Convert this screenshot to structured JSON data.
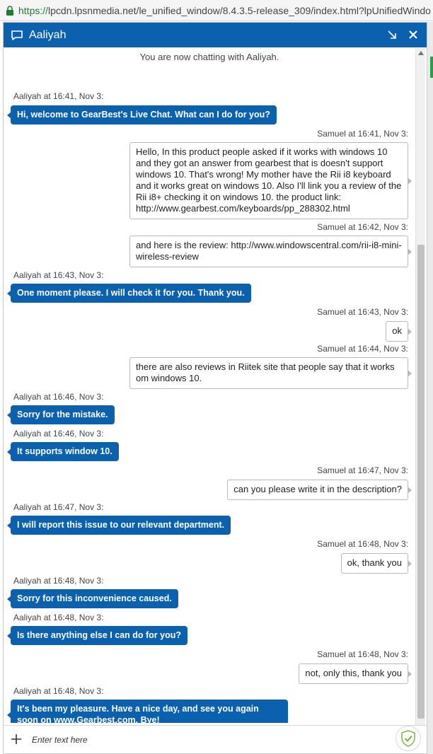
{
  "browser": {
    "url_scheme": "https://",
    "url_rest": "lpcdn.lpsnmedia.net/le_unified_window/8.4.3.5-release_309/index.html?lpUnifiedWindo"
  },
  "window": {
    "agent_name": "Aaliyah",
    "icons": {
      "chat": "chat-bubble-icon",
      "minimize": "minimize-arrow-icon",
      "close": "close-icon"
    },
    "accent_color": "#0b61ad"
  },
  "transcript": {
    "system_message": "You are now chatting with Aaliyah.",
    "messages": [
      {
        "sender": "agent",
        "meta": "Aaliyah at 16:41, Nov 3:",
        "text": "Hi, welcome to GearBest's Live Chat. What can I do for you?"
      },
      {
        "sender": "user",
        "meta": "Samuel at 16:41, Nov 3:",
        "text": "Hello, In this product people asked if it works with windows 10 and they got an answer from gearbest that is doesn't support windows 10. That's wrong! My mother have the Rii i8 keyboard and it works great on windows 10. Also I'll link you a review of the Rii i8+ checking it on windows 10. the product link: http://www.gearbest.com/keyboards/pp_288302.html"
      },
      {
        "sender": "user",
        "meta": "Samuel at 16:42, Nov 3:",
        "text": "and here is the review: http://www.windowscentral.com/rii-i8-mini-wireless-review"
      },
      {
        "sender": "agent",
        "meta": "Aaliyah at 16:43, Nov 3:",
        "text": "One moment please. I will check it for you. Thank you."
      },
      {
        "sender": "user",
        "meta": "Samuel at 16:43, Nov 3:",
        "text": "ok"
      },
      {
        "sender": "user",
        "meta": "Samuel at 16:44, Nov 3:",
        "text": "there are also reviews in Riitek site that people say that it works om windows 10."
      },
      {
        "sender": "agent",
        "meta": "Aaliyah at 16:46, Nov 3:",
        "text": "Sorry for the mistake."
      },
      {
        "sender": "agent",
        "meta": "Aaliyah at 16:46, Nov 3:",
        "text": "It supports window 10."
      },
      {
        "sender": "user",
        "meta": "Samuel at 16:47, Nov 3:",
        "text": "can you please write it in the description?"
      },
      {
        "sender": "agent",
        "meta": "Aaliyah at 16:47, Nov 3:",
        "text": "I will report this issue to our relevant department."
      },
      {
        "sender": "user",
        "meta": "Samuel at 16:48, Nov 3:",
        "text": "ok, thank you"
      },
      {
        "sender": "agent",
        "meta": "Aaliyah at 16:48, Nov 3:",
        "text": "Sorry for this inconvenience caused."
      },
      {
        "sender": "agent",
        "meta": "Aaliyah at 16:48, Nov 3:",
        "text": "Is there anything else I can do for you?"
      },
      {
        "sender": "user",
        "meta": "Samuel at 16:48, Nov 3:",
        "text": "not, only this, thank you"
      },
      {
        "sender": "agent",
        "meta": "Aaliyah at 16:48, Nov 3:",
        "text": "It's been my pleasure. Have a nice day, and see you again soon on www.Gearbest.com. Bye!"
      }
    ]
  },
  "composer": {
    "placeholder": "Enter text here",
    "icons": {
      "add": "plus-icon",
      "security": "shield-check-icon"
    }
  }
}
